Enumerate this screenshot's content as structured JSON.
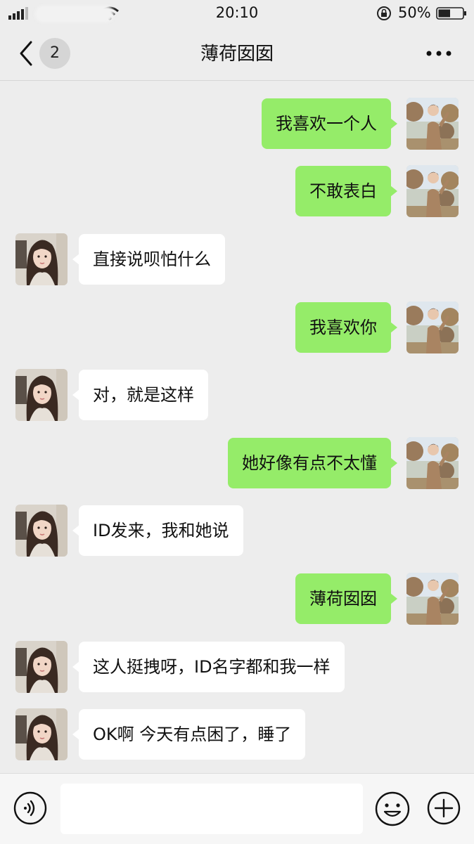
{
  "status_bar": {
    "time": "20:10",
    "battery_percent": "50%",
    "battery_level": 0.5,
    "icons": [
      "signal-icon",
      "wifi-icon",
      "rotation-lock-icon",
      "battery-icon"
    ]
  },
  "header": {
    "back_icon": "chevron-left-icon",
    "unread_badge": "2",
    "title": "薄荷囡囡",
    "more_icon": "more-dots-icon"
  },
  "messages": [
    {
      "side": "out",
      "text": "我喜欢一个人"
    },
    {
      "side": "out",
      "text": "不敢表白"
    },
    {
      "side": "in",
      "text": "直接说呗怕什么"
    },
    {
      "side": "out",
      "text": "我喜欢你"
    },
    {
      "side": "in",
      "text": "对，就是这样"
    },
    {
      "side": "out",
      "text": "她好像有点不太懂"
    },
    {
      "side": "in",
      "text": "ID发来，我和她说"
    },
    {
      "side": "out",
      "text": "薄荷囡囡"
    },
    {
      "side": "in",
      "text": "这人挺拽呀，ID名字都和我一样"
    },
    {
      "side": "in",
      "text": "OK啊 今天有点困了，睡了"
    }
  ],
  "input_bar": {
    "value": "",
    "icons": [
      "voice-icon",
      "emoji-icon",
      "plus-icon"
    ]
  },
  "colors": {
    "background": "#ededed",
    "outgoing_bubble": "#95ec69",
    "incoming_bubble": "#ffffff",
    "input_bar": "#f6f6f6"
  }
}
